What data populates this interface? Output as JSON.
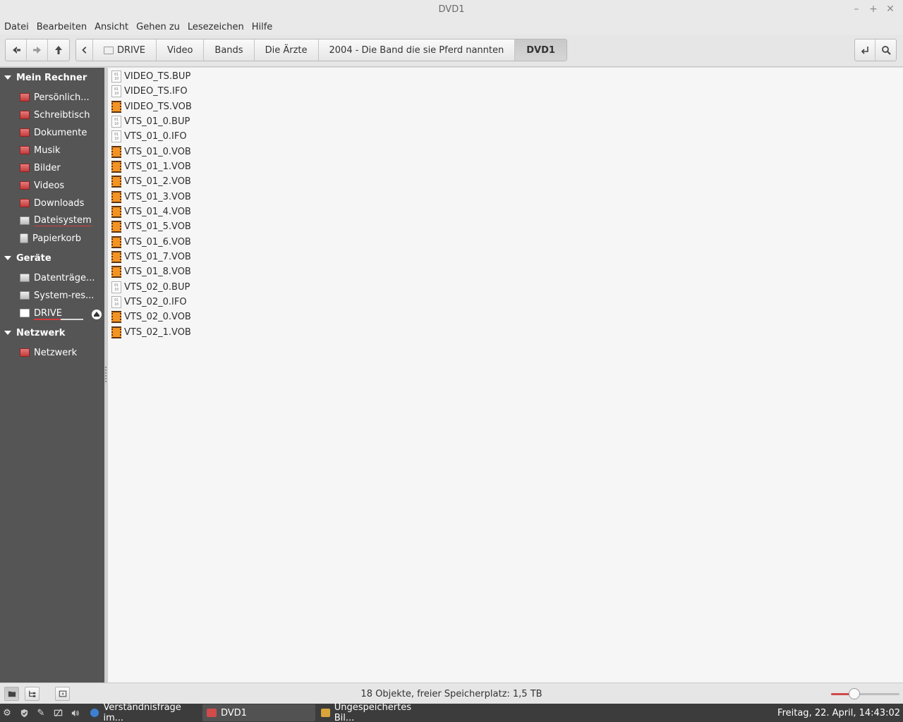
{
  "window": {
    "title": "DVD1"
  },
  "menubar": [
    "Datei",
    "Bearbeiten",
    "Ansicht",
    "Gehen zu",
    "Lesezeichen",
    "Hilfe"
  ],
  "breadcrumbs": [
    "DRIVE",
    "Video",
    "Bands",
    "Die Ärzte",
    "2004 - Die Band die sie Pferd nannten",
    "DVD1"
  ],
  "sidebar": {
    "sections": [
      {
        "title": "Mein Rechner",
        "items": [
          "Persönlich...",
          "Schreibtisch",
          "Dokumente",
          "Musik",
          "Bilder",
          "Videos",
          "Downloads",
          "Dateisystem",
          "Papierkorb"
        ]
      },
      {
        "title": "Geräte",
        "items": [
          "Datenträge...",
          "System-res...",
          "DRIVE"
        ]
      },
      {
        "title": "Netzwerk",
        "items": [
          "Netzwerk"
        ]
      }
    ]
  },
  "files": [
    {
      "name": "VIDEO_TS.BUP",
      "type": "bin"
    },
    {
      "name": "VIDEO_TS.IFO",
      "type": "bin"
    },
    {
      "name": "VIDEO_TS.VOB",
      "type": "vob"
    },
    {
      "name": "VTS_01_0.BUP",
      "type": "bin"
    },
    {
      "name": "VTS_01_0.IFO",
      "type": "bin"
    },
    {
      "name": "VTS_01_0.VOB",
      "type": "vob"
    },
    {
      "name": "VTS_01_1.VOB",
      "type": "vob"
    },
    {
      "name": "VTS_01_2.VOB",
      "type": "vob"
    },
    {
      "name": "VTS_01_3.VOB",
      "type": "vob"
    },
    {
      "name": "VTS_01_4.VOB",
      "type": "vob"
    },
    {
      "name": "VTS_01_5.VOB",
      "type": "vob"
    },
    {
      "name": "VTS_01_6.VOB",
      "type": "vob"
    },
    {
      "name": "VTS_01_7.VOB",
      "type": "vob"
    },
    {
      "name": "VTS_01_8.VOB",
      "type": "vob"
    },
    {
      "name": "VTS_02_0.BUP",
      "type": "bin"
    },
    {
      "name": "VTS_02_0.IFO",
      "type": "bin"
    },
    {
      "name": "VTS_02_0.VOB",
      "type": "vob"
    },
    {
      "name": "VTS_02_1.VOB",
      "type": "vob"
    }
  ],
  "status": {
    "text": "18 Objekte, freier Speicherplatz: 1,5 TB",
    "zoom_fraction": 0.34
  },
  "taskbar": {
    "tasks": [
      "Verständnisfrage im...",
      "DVD1",
      "Ungespeichertes Bil..."
    ],
    "clock": "Freitag, 22. April, 14:43:02"
  },
  "colors": {
    "sidebar_bg": "#555555",
    "file_area_bg": "#f6f6f6",
    "vob_icon": "#f39323",
    "accent_red": "#d23c3c",
    "panel_bg": "#3c3c3c"
  }
}
